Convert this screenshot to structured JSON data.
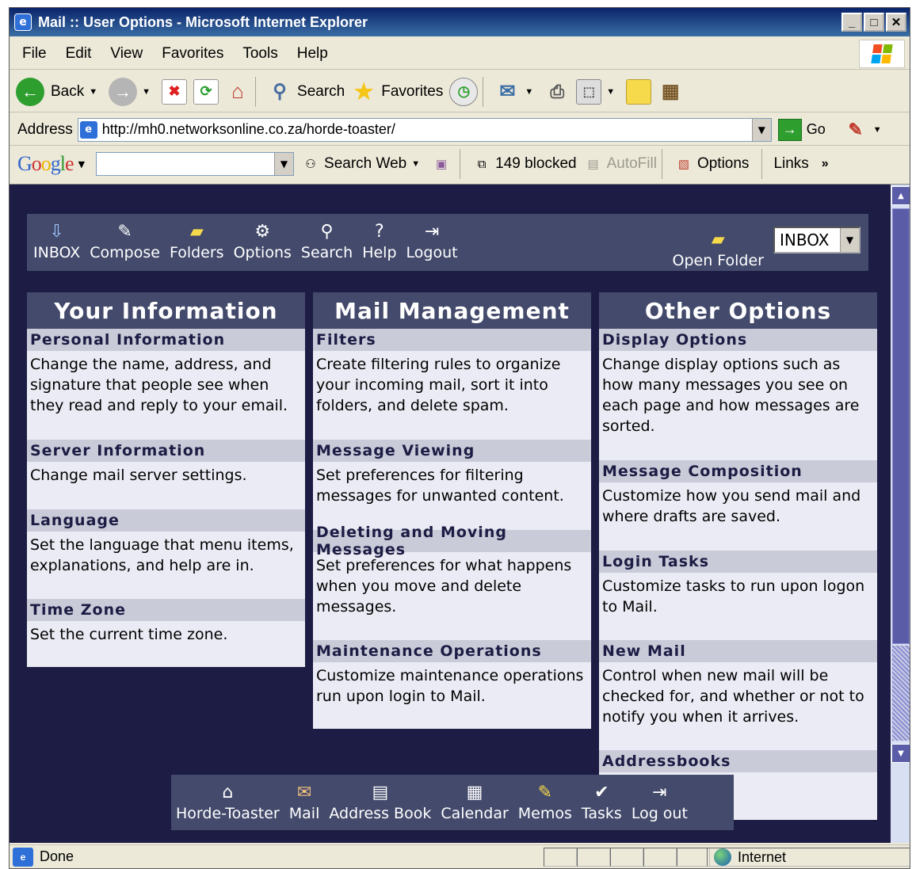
{
  "window": {
    "title": "Mail :: User Options - Microsoft Internet Explorer"
  },
  "menubar": {
    "items": [
      "File",
      "Edit",
      "View",
      "Favorites",
      "Tools",
      "Help"
    ]
  },
  "toolbar": {
    "back": "Back",
    "search": "Search",
    "favorites": "Favorites"
  },
  "address": {
    "label": "Address",
    "url": "http://mh0.networksonline.co.za/horde-toaster/",
    "go": "Go"
  },
  "google": {
    "logo": "Google",
    "search_web": "Search Web",
    "blocked": "149 blocked",
    "autofill": "AutoFill",
    "options": "Options",
    "links": "Links",
    "more": "»"
  },
  "horde_menu": {
    "items": [
      "INBOX",
      "Compose",
      "Folders",
      "Options",
      "Search",
      "Help",
      "Logout"
    ],
    "open_folder": "Open Folder",
    "folder_select": "INBOX"
  },
  "columns": [
    {
      "title": "Your Information",
      "sections": [
        {
          "head": "Personal Information",
          "body": "Change the name, address, and signature that people see when they read and reply to your email."
        },
        {
          "head": "Server Information",
          "body": "Change mail server settings."
        },
        {
          "head": "Language",
          "body": "Set the language that menu items, explanations, and help are in."
        },
        {
          "head": "Time Zone",
          "body": "Set the current time zone."
        }
      ]
    },
    {
      "title": "Mail Management",
      "sections": [
        {
          "head": "Filters",
          "body": "Create filtering rules to organize your incoming mail, sort it into folders, and delete spam."
        },
        {
          "head": "Message Viewing",
          "body": "Set preferences for filtering messages for unwanted content."
        },
        {
          "head": "Deleting and Moving Messages",
          "body": "Set preferences for what happens when you move and delete messages."
        },
        {
          "head": "Maintenance Operations",
          "body": "Customize maintenance operations run upon login to Mail."
        }
      ]
    },
    {
      "title": "Other Options",
      "sections": [
        {
          "head": "Display Options",
          "body": "Change display options such as how many messages you see on each page and how messages are sorted."
        },
        {
          "head": "Message Composition",
          "body": "Customize how you send mail and where drafts are saved."
        },
        {
          "head": "Login Tasks",
          "body": "Customize tasks to run upon logon to Mail."
        },
        {
          "head": "New Mail",
          "body": "Control when new mail will be checked for, and whether or not to notify you when it arrives."
        },
        {
          "head": "Addressbooks",
          "body": ""
        }
      ]
    }
  ],
  "bottom_menu": {
    "items": [
      "Horde-Toaster",
      "Mail",
      "Address Book",
      "Calendar",
      "Memos",
      "Tasks",
      "Log out"
    ]
  },
  "status": {
    "text": "Done",
    "zone": "Internet"
  },
  "colors": {
    "page_bg": "#1c1c44",
    "menu_bg": "#434a6b",
    "section_head": "#c9cbd9",
    "section_body": "#ebebf5"
  }
}
